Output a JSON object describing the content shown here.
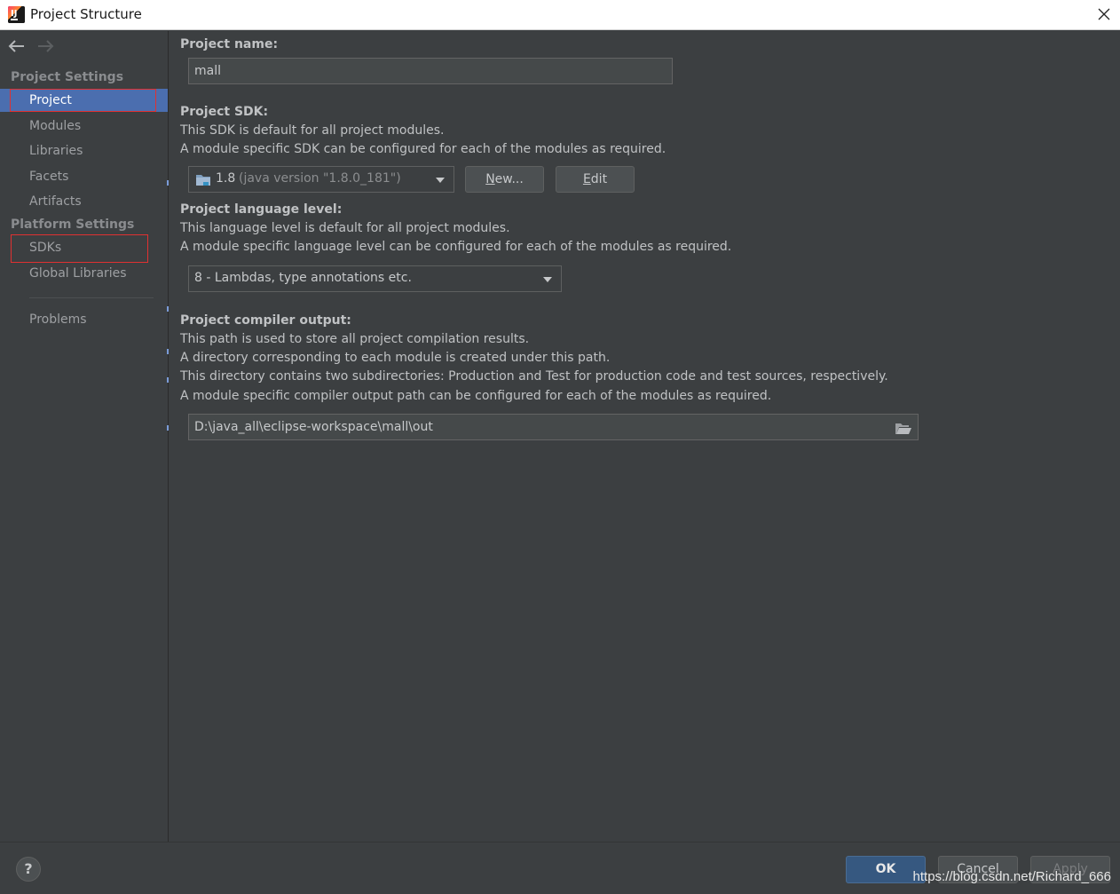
{
  "window": {
    "title": "Project Structure"
  },
  "sidebar": {
    "project_settings_header": "Project Settings",
    "project_settings_items": [
      {
        "label": "Project"
      },
      {
        "label": "Modules"
      },
      {
        "label": "Libraries"
      },
      {
        "label": "Facets"
      },
      {
        "label": "Artifacts"
      }
    ],
    "platform_settings_header": "Platform Settings",
    "platform_settings_items": [
      {
        "label": "SDKs"
      },
      {
        "label": "Global Libraries"
      }
    ],
    "problems_label": "Problems"
  },
  "project": {
    "name_label": "Project name:",
    "name_value": "mall",
    "sdk_label": "Project SDK:",
    "sdk_desc_1": "This SDK is default for all project modules.",
    "sdk_desc_2": "A module specific SDK can be configured for each of the modules as required.",
    "sdk_selected_version": "1.8",
    "sdk_selected_detail": "(java version \"1.8.0_181\")",
    "new_button": "New...",
    "edit_button": "Edit",
    "lang_label": "Project language level:",
    "lang_desc_1": "This language level is default for all project modules.",
    "lang_desc_2": "A module specific language level can be configured for each of the modules as required.",
    "lang_selected": "8 - Lambdas, type annotations etc.",
    "output_label": "Project compiler output:",
    "output_desc_1": "This path is used to store all project compilation results.",
    "output_desc_2": "A directory corresponding to each module is created under this path.",
    "output_desc_3": "This directory contains two subdirectories: Production and Test for production code and test sources, respectively.",
    "output_desc_4": "A module specific compiler output path can be configured for each of the modules as required.",
    "output_path": "D:\\java_all\\eclipse-workspace\\mall\\out"
  },
  "footer": {
    "help": "?",
    "ok": "OK",
    "cancel": "Cancel",
    "apply": "Apply",
    "watermark": "https://blog.csdn.net/Richard_666"
  },
  "colors": {
    "background": "#3c3f41",
    "selection": "#4b6eaf",
    "ok_button": "#365880",
    "highlight_box": "#e03131"
  }
}
